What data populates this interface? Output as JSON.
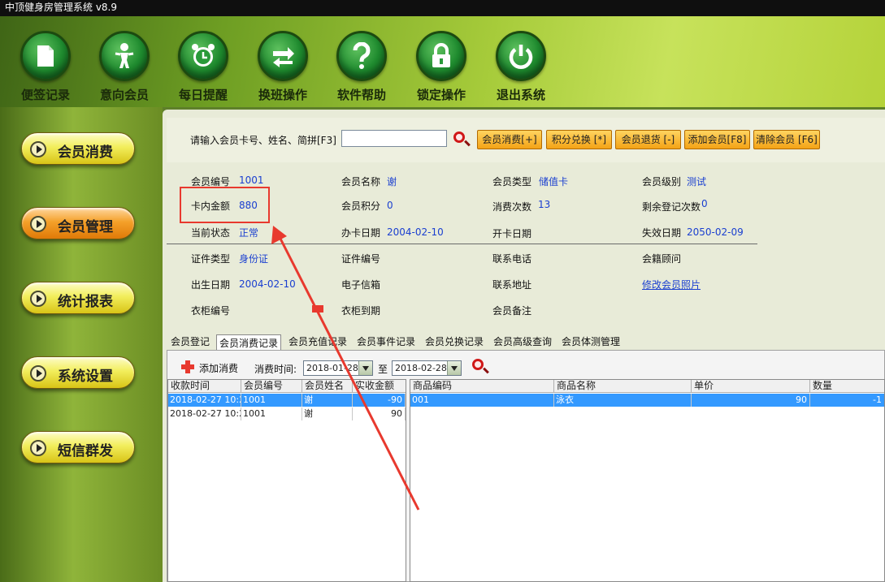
{
  "window": {
    "title": "中顶健身房管理系统  v8.9"
  },
  "toolbar": [
    {
      "label": "便签记录",
      "icon": "document-icon"
    },
    {
      "label": "意向会员",
      "icon": "person-icon"
    },
    {
      "label": "每日提醒",
      "icon": "alarm-clock-icon"
    },
    {
      "label": "换班操作",
      "icon": "swap-arrows-icon"
    },
    {
      "label": "软件帮助",
      "icon": "question-icon"
    },
    {
      "label": "锁定操作",
      "icon": "lock-icon"
    },
    {
      "label": "退出系统",
      "icon": "power-icon"
    }
  ],
  "sidebar": [
    {
      "label": "会员消费",
      "style": "yellow"
    },
    {
      "label": "会员管理",
      "style": "orange"
    },
    {
      "label": "统计报表",
      "style": "yellow"
    },
    {
      "label": "系统设置",
      "style": "yellow"
    },
    {
      "label": "短信群发",
      "style": "yellow"
    }
  ],
  "search": {
    "prompt": "请输入会员卡号、姓名、简拼[F3]",
    "value": "",
    "buttons": [
      "会员消费[+]",
      "积分兑换 [*]",
      "会员退货 [-]",
      "添加会员[F8]",
      "清除会员 [F6]"
    ]
  },
  "member": {
    "labels": {
      "id": "会员编号",
      "name": "会员名称",
      "type": "会员类型",
      "level": "会员级别",
      "balance": "卡内金额",
      "points": "会员积分",
      "visits": "消费次数",
      "remaining": "剩余登记次数",
      "status": "当前状态",
      "issue_date": "办卡日期",
      "open_date": "开卡日期",
      "expire_date": "失效日期",
      "cert_type": "证件类型",
      "cert_no": "证件编号",
      "phone": "联系电话",
      "advisor": "会籍顾问",
      "birth": "出生日期",
      "email": "电子信箱",
      "address": "联系地址",
      "locker_no": "衣柜编号",
      "locker_due": "衣柜到期",
      "remark": "会员备注"
    },
    "values": {
      "id": "1001",
      "name": "谢",
      "type": "储值卡",
      "level": "测试",
      "balance": "880",
      "points": "0",
      "visits": "13",
      "remaining": "0",
      "status": "正常",
      "issue_date": "2004-02-10",
      "expire_date": "2050-02-09",
      "cert_type": "身份证",
      "birth": "2004-02-10"
    },
    "photo_link": "修改会员照片"
  },
  "tabs": [
    "会员登记",
    "会员消费记录",
    "会员充值记录",
    "会员事件记录",
    "会员兑换记录",
    "会员高级查询",
    "会员体测管理"
  ],
  "active_tab": 1,
  "consumption": {
    "add_label": "添加消费",
    "time_label": "消费时间:",
    "from": "2018-01-28",
    "to_label": "至",
    "to": "2018-02-28"
  },
  "left_table": {
    "headers": [
      "收款时间",
      "会员编号",
      "会员姓名",
      "实收金额"
    ],
    "rows": [
      [
        "2018-02-27 10:2",
        "1001",
        "谢",
        "-90"
      ],
      [
        "2018-02-27 10:2",
        "1001",
        "谢",
        "90"
      ]
    ]
  },
  "right_table": {
    "headers": [
      "商品编码",
      "商品名称",
      "单价",
      "数量"
    ],
    "rows": [
      [
        "001",
        "泳衣",
        "90",
        "-1"
      ]
    ]
  },
  "colors": {
    "accent_red": "#e8392e",
    "link_blue": "#1a3fd0",
    "selection": "#3399ff"
  }
}
